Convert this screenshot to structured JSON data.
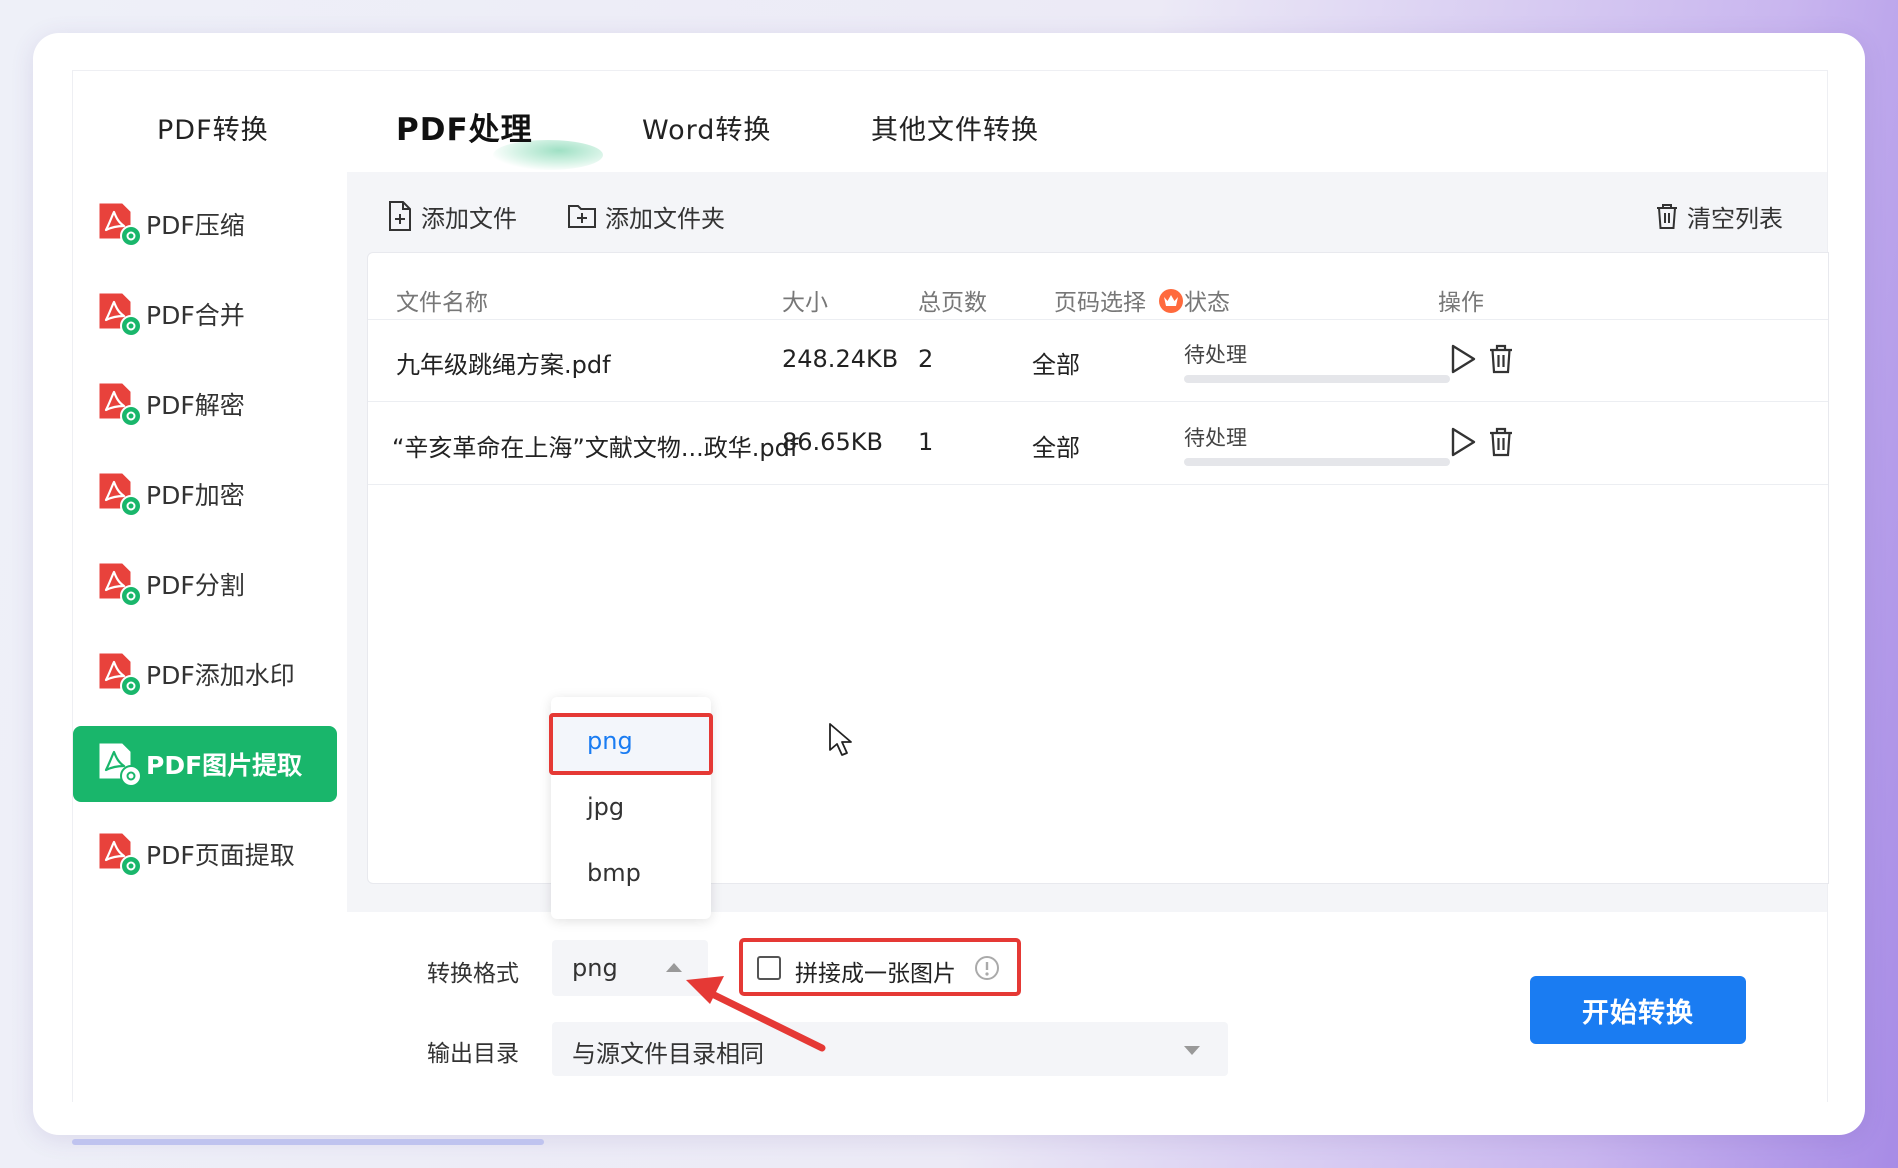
{
  "top_tabs": [
    {
      "label": "PDF转换"
    },
    {
      "label": "PDF处理"
    },
    {
      "label": "Word转换"
    },
    {
      "label": "其他文件转换"
    }
  ],
  "sidebar": {
    "items": [
      {
        "label": "PDF压缩"
      },
      {
        "label": "PDF合并"
      },
      {
        "label": "PDF解密"
      },
      {
        "label": "PDF加密"
      },
      {
        "label": "PDF分割"
      },
      {
        "label": "PDF添加水印"
      },
      {
        "label": "PDF图片提取"
      },
      {
        "label": "PDF页面提取"
      }
    ],
    "active": "PDF图片提取"
  },
  "toolbar": {
    "add_file": "添加文件",
    "add_folder": "添加文件夹",
    "clear_list": "清空列表"
  },
  "table": {
    "headers": {
      "name": "文件名称",
      "size": "大小",
      "pages": "总页数",
      "range": "页码选择",
      "status": "状态",
      "actions": "操作"
    },
    "rows": [
      {
        "name": "九年级跳绳方案.pdf",
        "size": "248.24KB",
        "pages": "2",
        "range": "全部",
        "status": "待处理",
        "progress": 0
      },
      {
        "name": "“辛亥革命在上海”文献文物...政华.pdf",
        "size": "86.65KB",
        "pages": "1",
        "range": "全部",
        "status": "待处理",
        "progress": 0
      }
    ]
  },
  "settings": {
    "format_label": "转换格式",
    "format_value": "png",
    "merge_label": "拼接成一张图片",
    "output_label": "输出目录",
    "output_value": "与源文件目录相同",
    "start_button": "开始转换"
  },
  "dropdown": {
    "options": [
      "png",
      "jpg",
      "bmp"
    ],
    "selected": "png"
  },
  "colors": {
    "accent_green": "#19b66b",
    "primary_blue": "#1a7cf2",
    "highlight_red": "#e53935",
    "pdf_red": "#e8423c"
  },
  "icons": {
    "add_file": "file-plus-icon",
    "add_folder": "folder-plus-icon",
    "clear": "trash-icon",
    "play": "play-icon",
    "delete": "trash-icon",
    "vip": "crown-icon",
    "info": "info-icon",
    "caret_up": "caret-up-icon",
    "caret_down": "caret-down-icon",
    "pointer": "mouse-cursor-icon"
  }
}
